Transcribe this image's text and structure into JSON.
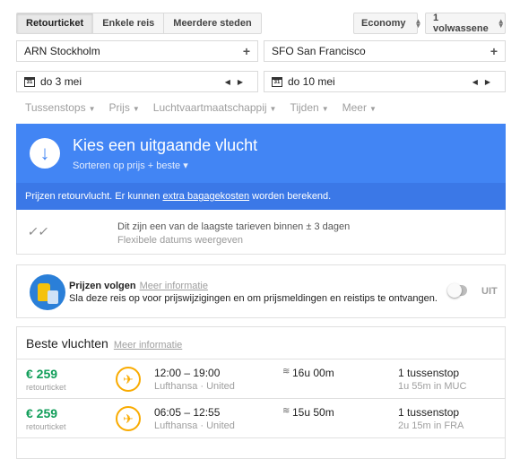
{
  "trip_tabs": [
    "Retourticket",
    "Enkele reis",
    "Meerdere steden"
  ],
  "cabin_class": "Economy",
  "passengers": "1 volwassene",
  "origin": {
    "code": "ARN",
    "city": "Stockholm"
  },
  "destination": {
    "code": "SFO",
    "city": "San Francisco"
  },
  "depart_date": "do 3 mei",
  "return_date": "do 10 mei",
  "calendar_day": "31",
  "filters": [
    "Tussenstops",
    "Prijs",
    "Luchtvaartmaatschappij",
    "Tijden",
    "Meer"
  ],
  "outbound": {
    "title": "Kies een uitgaande vlucht",
    "sort": "Sorteren op prijs + beste ▾",
    "note_pre": "Prijzen retourvlucht. Er kunnen ",
    "note_link": "extra bagagekosten",
    "note_post": " worden berekend."
  },
  "tip": {
    "line1": "Dit zijn een van de laagste tarieven binnen ± 3 dagen",
    "line2": "Flexibele datums weergeven"
  },
  "track": {
    "title": "Prijzen volgen",
    "link": "Meer informatie",
    "desc": "Sla deze reis op voor prijswijzigingen en om prijsmeldingen en reistips te ontvangen.",
    "toggle_label": "UIT",
    "enabled": false
  },
  "best": {
    "title": "Beste vluchten",
    "link": "Meer informatie"
  },
  "flights": [
    {
      "price": "€ 259",
      "price_sub": "retourticket",
      "times": "12:00 – 19:00",
      "carrier": "Lufthansa · United",
      "duration": "16u 00m",
      "stops": "1 tussenstop",
      "layover": "1u 55m in MUC"
    },
    {
      "price": "€ 259",
      "price_sub": "retourticket",
      "times": "06:05 – 12:55",
      "carrier": "Lufthansa · United",
      "duration": "15u 50m",
      "stops": "1 tussenstop",
      "layover": "2u 15m in FRA"
    }
  ],
  "colors": {
    "accent_blue": "#4285f4",
    "price_green": "#0f9d58",
    "airline_yellow": "#f9ab00"
  }
}
